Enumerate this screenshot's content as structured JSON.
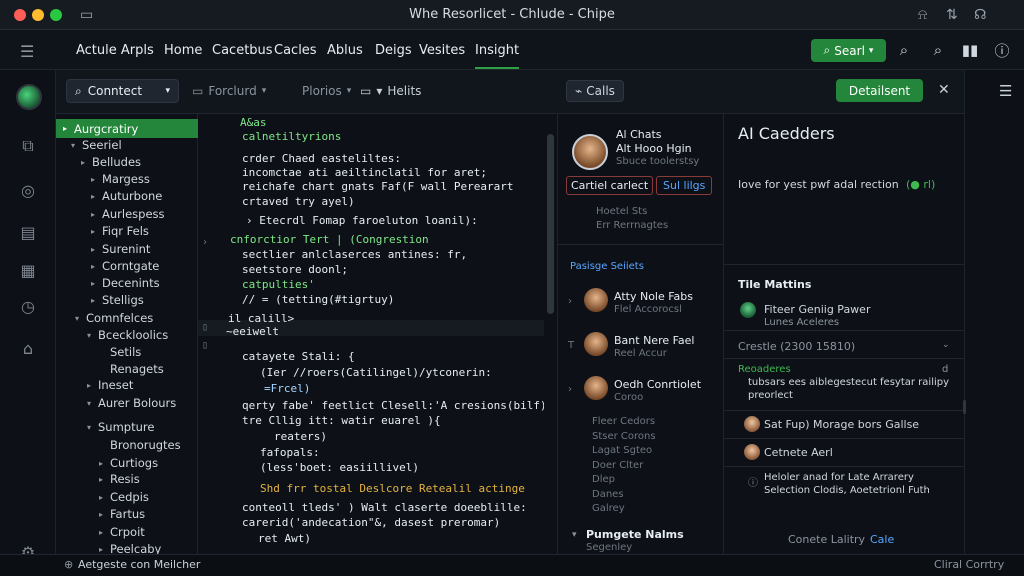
{
  "window": {
    "title": "Whe Resorlicet - Chlude - Chipe"
  },
  "menu": {
    "items": [
      "Actule Arpls",
      "Home",
      "Cacetbus",
      "Cacles",
      "Ablus",
      "Deigs",
      "Vesites",
      "Insight"
    ],
    "active_index": 7
  },
  "search_button": {
    "label": "Searl"
  },
  "toolbar": {
    "context": "Conntect",
    "tools": [
      "Forclurd",
      "Plorios",
      "Helits"
    ]
  },
  "tree": {
    "items": [
      {
        "label": "Aurgcratiry",
        "twisty": "▸",
        "selected": true
      },
      {
        "label": "Seeriel",
        "twisty": "▾"
      },
      {
        "label": "Belludes",
        "twisty": "▸"
      },
      {
        "label": "Margess",
        "twisty": "▸"
      },
      {
        "label": "Auturbone",
        "twisty": "▸"
      },
      {
        "label": "Aurlespess",
        "twisty": "▸"
      },
      {
        "label": "Fiqr Fels",
        "twisty": "▸"
      },
      {
        "label": "Surenint",
        "twisty": "▸"
      },
      {
        "label": "Corntgate",
        "twisty": "▸"
      },
      {
        "label": "Decenints",
        "twisty": "▸"
      },
      {
        "label": "Stelligs",
        "twisty": "▸"
      },
      {
        "label": "Comnfelces",
        "twisty": "▾"
      },
      {
        "label": "Bceckloolics",
        "twisty": "▾"
      },
      {
        "label": "Setils",
        "twisty": ""
      },
      {
        "label": "Renagets",
        "twisty": ""
      },
      {
        "label": "Ineset",
        "twisty": "▸"
      },
      {
        "label": "Aurer Bolours",
        "twisty": "▾"
      },
      {
        "label": "Sumpture",
        "twisty": "▾"
      },
      {
        "label": "Bronorugtes",
        "twisty": ""
      },
      {
        "label": "Curtiogs",
        "twisty": "▸"
      },
      {
        "label": "Resis",
        "twisty": "▸"
      },
      {
        "label": "Cedpis",
        "twisty": "▸"
      },
      {
        "label": "Fartus",
        "twisty": "▸"
      },
      {
        "label": "Crpoit",
        "twisty": "▸"
      },
      {
        "label": "Peelcaby",
        "twisty": "▸"
      }
    ]
  },
  "editor": {
    "lines": [
      "A&as",
      "calnetiltyrions",
      "crder Chaed easteliltes:",
      "incomctae ati aeiltinclatil for aret;",
      "reichafe chart gnats Faf(F wall Perearart",
      "crtaved try ayel)",
      "› Etecrdl Fomap faroeluton loanil):",
      "cnforctior Tert | (Congrestion",
      "sectlier anlclaserces antines: fr,",
      "seetstore doonl;",
      "catpulties'",
      "// = (tetting(#tigrtuy)",
      "il calill>",
      "~eeiwelt",
      "catayete Stali: {",
      "(Ier //roers(Catilingel)/ytconerin:",
      "=Frcel)",
      "qerty fabe' feetlict Clesell:'A cresions(bilf);",
      "tre Cllig itt: watir euarel ){",
      "reaters)",
      "fafopals:",
      "(less'boet: easiillivel)",
      "Shd frr tostal Deslcore Retealil actinge",
      "conteoll tleds' ) Walt claserte doeeblille:",
      "carerid('andecation\"&, dasest preromar)",
      "ret Awt)"
    ]
  },
  "chat": {
    "tab": "Calls",
    "header": {
      "line1": "Al Chats",
      "line2": "Alt Hooo Hgin",
      "line3": "Sbuce toolerstsy"
    },
    "buttons": [
      "Cartiel carlect",
      "Sul lilgs"
    ],
    "sub": [
      "Hoetel Sts",
      "Err Rerrnagtes"
    ],
    "section": "Pasisge Seiiets",
    "contacts": [
      {
        "name": "Atty Nole Fabs",
        "sub": "Flel Accorocsl",
        "twisty": "›"
      },
      {
        "name": "Bant Nere Fael",
        "sub": "Reel Accur",
        "twisty": "T"
      },
      {
        "name": "Oedh Conrtiolet",
        "sub": "Coroo",
        "twisty": "›"
      }
    ],
    "list": [
      "Fleer Cedors",
      "Stser Corons",
      "Lagat Sgteo",
      "Doer Clter",
      "Dlep",
      "Danes",
      "Galrey"
    ],
    "footer": {
      "title": "Pumgete Nalms",
      "sub": "Segenley"
    }
  },
  "right": {
    "button": "Detailsent",
    "title": "AI Caedders",
    "desc": "Iove for yest pwf adal rection",
    "desc_badge": "(● rl)",
    "section": "Tile Mattins",
    "user": {
      "name": "Fiteer Geniig Pawer",
      "sub": "Lunes Aceleres"
    },
    "select": {
      "label": "Crestle (2300 15810)"
    },
    "notice": {
      "title": "Reoaderes",
      "line1": "tubsars ees aiblegestecut fesytar railipy",
      "line2": "preorlect",
      "marker": "d"
    },
    "items": [
      "Sat Fup) Morage bors Gallse",
      "Cetnete Aerl"
    ],
    "info": {
      "line1": "Heloler anad for Late Arrarery",
      "line2": "Selection Clodis, Aoetetrionl Futh"
    },
    "footer": {
      "label": "Conete Lalitry",
      "badge": "Cale"
    }
  },
  "status": {
    "left": "Aetgeste con Meilcher",
    "right": "Cliral Corrtry"
  },
  "colors": {
    "accent": "#23863a",
    "bg": "#0d1117"
  }
}
